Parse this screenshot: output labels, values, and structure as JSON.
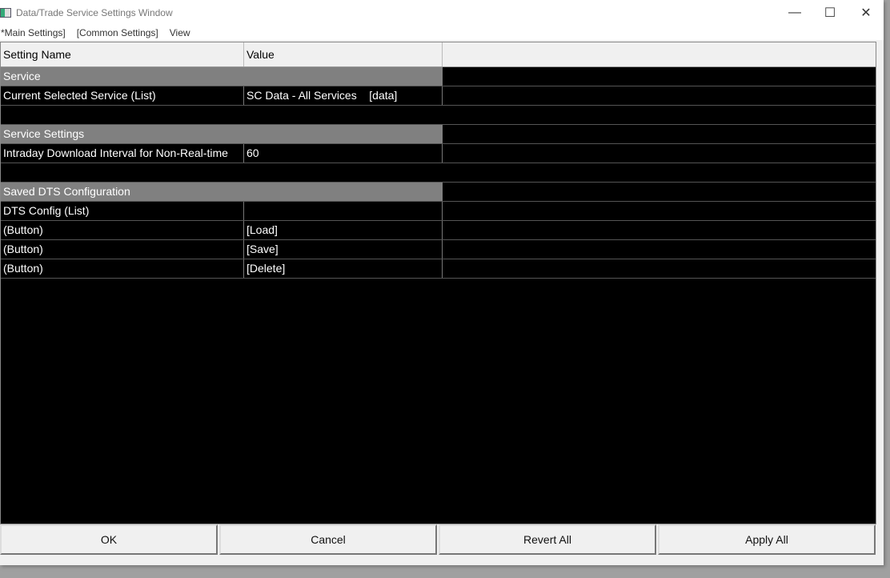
{
  "window": {
    "title": "Data/Trade Service Settings Window",
    "minimize": "—",
    "maximize": "☐",
    "close": "✕"
  },
  "menu": [
    "*Main Settings]",
    "[Common Settings]",
    "View"
  ],
  "table": {
    "headers": [
      "Setting Name",
      "Value"
    ],
    "rows": [
      {
        "type": "section",
        "name": "Service"
      },
      {
        "type": "item",
        "name": "Current Selected Service (List)",
        "value": "SC Data - All Services    [data]"
      },
      {
        "type": "empty"
      },
      {
        "type": "section",
        "name": "Service Settings"
      },
      {
        "type": "item",
        "name": "Intraday Download Interval for Non-Real-time",
        "value": "60"
      },
      {
        "type": "empty"
      },
      {
        "type": "section",
        "name": "Saved DTS Configuration"
      },
      {
        "type": "item",
        "name": "DTS Config (List)",
        "value": ""
      },
      {
        "type": "item",
        "name": "(Button)",
        "value": "[Load]"
      },
      {
        "type": "item",
        "name": "(Button)",
        "value": "[Save]"
      },
      {
        "type": "item",
        "name": "(Button)",
        "value": "[Delete]"
      }
    ]
  },
  "buttons": [
    "OK",
    "Cancel",
    "Revert All",
    "Apply All"
  ]
}
